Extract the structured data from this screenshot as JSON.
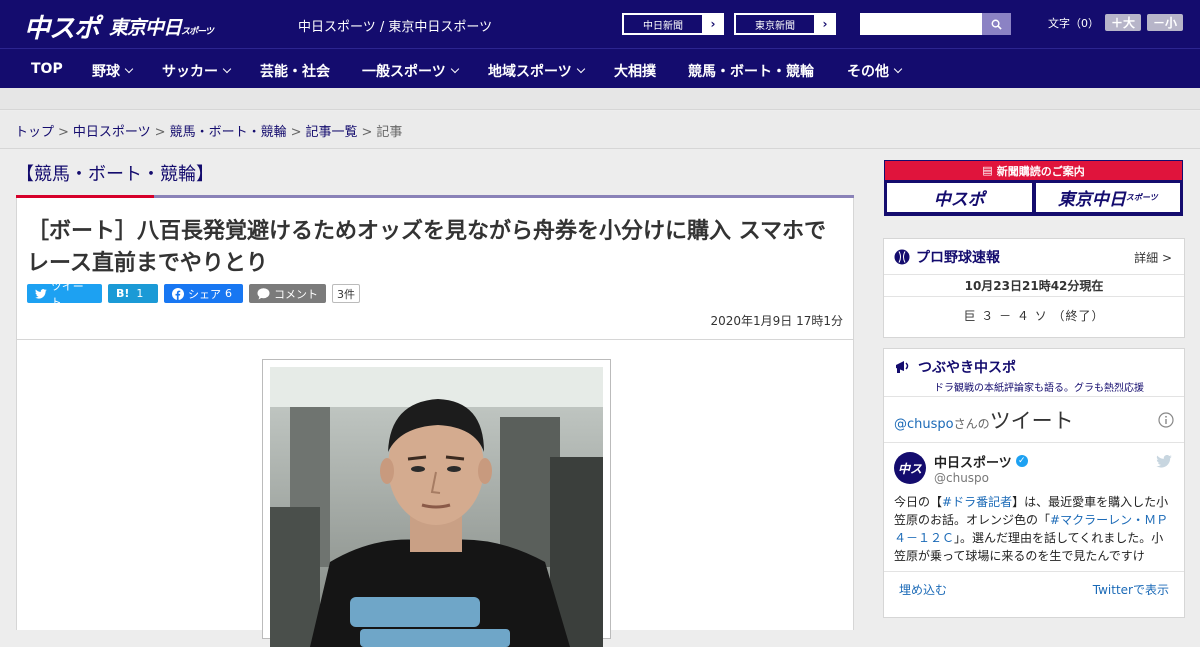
{
  "header": {
    "logo_main": "中スポ",
    "logo_sub": "東京中日",
    "logo_sub_small": "スポーツ",
    "site_links": "中日スポーツ / 東京中日スポーツ",
    "paper_buttons": [
      {
        "label": "中日新聞"
      },
      {
        "label": "東京新聞"
      }
    ],
    "search": {
      "value": "",
      "placeholder": ""
    },
    "font_size_label": "文字（0）",
    "font_larger": "＋大",
    "font_smaller": "－小"
  },
  "nav": {
    "items": [
      {
        "label": "TOP",
        "has_dropdown": false
      },
      {
        "label": "野球",
        "has_dropdown": true
      },
      {
        "label": "サッカー",
        "has_dropdown": true
      },
      {
        "label": "芸能・社会",
        "has_dropdown": false
      },
      {
        "label": "一般スポーツ",
        "has_dropdown": true
      },
      {
        "label": "地域スポーツ",
        "has_dropdown": true
      },
      {
        "label": "大相撲",
        "has_dropdown": false
      },
      {
        "label": "競馬・ボート・競輪",
        "has_dropdown": false
      },
      {
        "label": "その他",
        "has_dropdown": true
      }
    ]
  },
  "breadcrumb": {
    "items": [
      "トップ",
      "中日スポーツ",
      "競馬・ボート・競輪",
      "記事一覧"
    ],
    "current": "記事",
    "separator": ">"
  },
  "article": {
    "category": "【競馬・ボート・競輪】",
    "headline_line1": "［ボート］八百長発覚避けるためオッズを見ながら舟券を小分けに購入 スマホで",
    "headline_line2": "レース直前までやりとり",
    "share": {
      "tweet": "ツイート",
      "hatena": "B!",
      "hatena_count": "1",
      "facebook": "シェア",
      "facebook_count": "6",
      "comment": "コメント",
      "comment_count": "3件"
    },
    "date": "2020年1月9日 17時1分"
  },
  "sidebar": {
    "banner_title": "新聞購読のご案内",
    "banner_btn1": "中スポ",
    "banner_btn2": "東京中日",
    "banner_btn2_small": "スポーツ",
    "baseball": {
      "title": "プロ野球速報",
      "detail": "詳細 >",
      "timestamp": "10月23日21時42分現在",
      "score": "巨 ３ － ４ ソ （終了）"
    },
    "tsubuyaki": {
      "title": "つぶやき中スポ",
      "subtitle": "ドラ観戦の本紙評論家も語る。グラも熱烈応援",
      "user": "@chuspo",
      "san": "さんの",
      "tweet_label": "ツイート",
      "name": "中日スポーツ",
      "handle": "@chuspo",
      "text_1": "今日の【",
      "text_hash1": "#ドラ番記者",
      "text_2": "】は、最近愛車を購入した小笠原のお話。オレンジ色の「",
      "text_hash2": "#マクラーレン・ＭＰ４－１２Ｃ",
      "text_3": "」。選んだ理由を話してくれました。小笠原が乗って球場に来るのを生で見たんですけ",
      "embed": "埋め込む",
      "view_on": "Twitterで表示"
    }
  },
  "colors": {
    "brand_navy": "#140c6e",
    "accent_red": "#d6002a",
    "twitter_blue": "#1da1f2",
    "facebook_blue": "#1877f2"
  }
}
